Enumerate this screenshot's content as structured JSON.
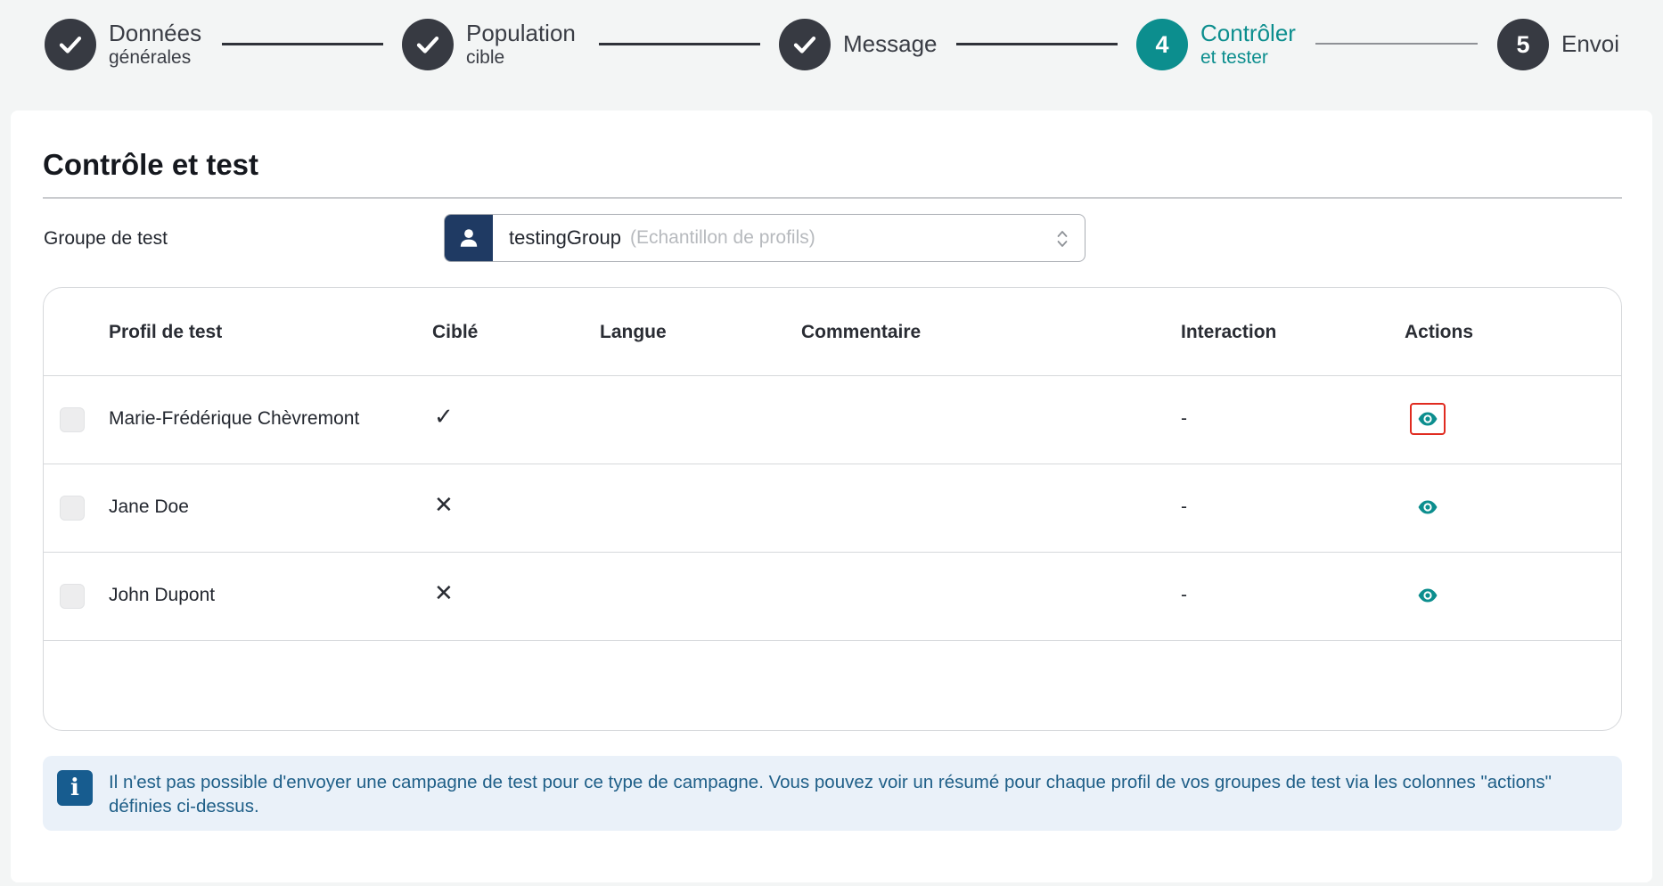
{
  "stepper": {
    "steps": [
      {
        "title": "Données",
        "subtitle": "générales",
        "state": "done"
      },
      {
        "title": "Population",
        "subtitle": "cible",
        "state": "done"
      },
      {
        "title": "Message",
        "subtitle": "",
        "state": "done"
      },
      {
        "number": "4",
        "title": "Contrôler",
        "subtitle": "et tester",
        "state": "active"
      },
      {
        "number": "5",
        "title": "Envoi",
        "subtitle": "",
        "state": "pending"
      }
    ]
  },
  "section": {
    "title": "Contrôle et test"
  },
  "test_group": {
    "label": "Groupe de test",
    "value": "testingGroup",
    "hint": "(Echantillon de profils)"
  },
  "table": {
    "columns": [
      "Profil de test",
      "Ciblé",
      "Langue",
      "Commentaire",
      "Interaction",
      "Actions"
    ],
    "rows": [
      {
        "profile": "Marie-Frédérique Chèvremont",
        "targeted": "✓",
        "language": "",
        "comment": "",
        "interaction": "-"
      },
      {
        "profile": "Jane Doe",
        "targeted": "✕",
        "language": "",
        "comment": "",
        "interaction": "-"
      },
      {
        "profile": "John Dupont",
        "targeted": "✕",
        "language": "",
        "comment": "",
        "interaction": "-"
      }
    ]
  },
  "info": {
    "icon": "i",
    "text": "Il n'est pas possible d'envoyer une campagne de test pour ce type de campagne. Vous pouvez voir un résumé pour chaque profil de vos groupes de test via les colonnes \"actions\" définies ci-dessus."
  },
  "colors": {
    "accent": "#0c8e8e",
    "step_dark": "#373a42",
    "info_text": "#1f5f88",
    "info_bg": "#eaf1f9",
    "focus_outline": "#e02b20"
  }
}
